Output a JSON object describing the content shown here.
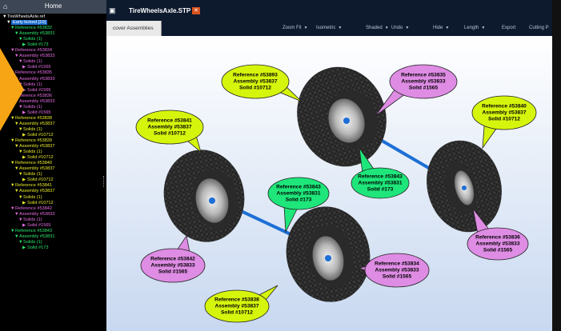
{
  "colors": {
    "yellow": "#d6f50d",
    "pink": "#de8ce4",
    "green": "#1ee67a",
    "selection": "#1e6fd0",
    "tab_close": "#d9531e"
  },
  "left_panel": {
    "home_label": "Home",
    "home_icon": "home-icon",
    "tree": [
      {
        "text": "TireWheelsAxle.ref",
        "color": "#ffffff",
        "indent": 0,
        "tri": "down"
      },
      {
        "text": "Early kicked [10]",
        "color": "#ffffff",
        "indent": 1,
        "tri": "down",
        "selected": true
      },
      {
        "text": "Reference #53832",
        "color": "#2de86d",
        "indent": 2,
        "tri": "down"
      },
      {
        "text": "Assembly #53831",
        "color": "#2de86d",
        "indent": 3,
        "tri": "down"
      },
      {
        "text": "Solids (1)",
        "color": "#2de86d",
        "indent": 4,
        "tri": "down"
      },
      {
        "text": "Solid #173",
        "color": "#2de86d",
        "indent": 5,
        "tri": "right"
      },
      {
        "text": "Reference #53834",
        "color": "#e86de4",
        "indent": 2,
        "tri": "down"
      },
      {
        "text": "Assembly #53833",
        "color": "#e86de4",
        "indent": 3,
        "tri": "down"
      },
      {
        "text": "Solids (1)",
        "color": "#e86de4",
        "indent": 4,
        "tri": "down"
      },
      {
        "text": "Solid #1565",
        "color": "#e86de4",
        "indent": 5,
        "tri": "right"
      },
      {
        "text": "Reference #53835",
        "color": "#e86de4",
        "indent": 2,
        "tri": "down"
      },
      {
        "text": "Assembly #53833",
        "color": "#e86de4",
        "indent": 3,
        "tri": "down"
      },
      {
        "text": "Solids (1)",
        "color": "#e86de4",
        "indent": 4,
        "tri": "down"
      },
      {
        "text": "Solid #1565",
        "color": "#e86de4",
        "indent": 5,
        "tri": "right"
      },
      {
        "text": "Reference #53836",
        "color": "#e86de4",
        "indent": 2,
        "tri": "down"
      },
      {
        "text": "Assembly #53833",
        "color": "#e86de4",
        "indent": 3,
        "tri": "down"
      },
      {
        "text": "Solids (1)",
        "color": "#e86de4",
        "indent": 4,
        "tri": "down"
      },
      {
        "text": "Solid #1565",
        "color": "#e86de4",
        "indent": 5,
        "tri": "right"
      },
      {
        "text": "Reference #53838",
        "color": "#e8ea2a",
        "indent": 2,
        "tri": "down"
      },
      {
        "text": "Assembly #53837",
        "color": "#e8ea2a",
        "indent": 3,
        "tri": "down"
      },
      {
        "text": "Solids (1)",
        "color": "#e8ea2a",
        "indent": 4,
        "tri": "down"
      },
      {
        "text": "Solid #10712",
        "color": "#e8ea2a",
        "indent": 5,
        "tri": "right"
      },
      {
        "text": "Reference #53839",
        "color": "#e8ea2a",
        "indent": 2,
        "tri": "down"
      },
      {
        "text": "Assembly #53837",
        "color": "#e8ea2a",
        "indent": 3,
        "tri": "down"
      },
      {
        "text": "Solids (1)",
        "color": "#e8ea2a",
        "indent": 4,
        "tri": "down"
      },
      {
        "text": "Solid #10712",
        "color": "#e8ea2a",
        "indent": 5,
        "tri": "right"
      },
      {
        "text": "Reference #53840",
        "color": "#e8ea2a",
        "indent": 2,
        "tri": "down"
      },
      {
        "text": "Assembly #53837",
        "color": "#e8ea2a",
        "indent": 3,
        "tri": "down"
      },
      {
        "text": "Solids (1)",
        "color": "#e8ea2a",
        "indent": 4,
        "tri": "down"
      },
      {
        "text": "Solid #10712",
        "color": "#e8ea2a",
        "indent": 5,
        "tri": "right"
      },
      {
        "text": "Reference #53841",
        "color": "#e8ea2a",
        "indent": 2,
        "tri": "down"
      },
      {
        "text": "Assembly #53837",
        "color": "#e8ea2a",
        "indent": 3,
        "tri": "down"
      },
      {
        "text": "Solids (1)",
        "color": "#e8ea2a",
        "indent": 4,
        "tri": "down"
      },
      {
        "text": "Solid #10712",
        "color": "#e8ea2a",
        "indent": 5,
        "tri": "right"
      },
      {
        "text": "Reference #53842",
        "color": "#e86de4",
        "indent": 2,
        "tri": "down"
      },
      {
        "text": "Assembly #53833",
        "color": "#e86de4",
        "indent": 3,
        "tri": "down"
      },
      {
        "text": "Solids (1)",
        "color": "#e86de4",
        "indent": 4,
        "tri": "down"
      },
      {
        "text": "Solid #1565",
        "color": "#e86de4",
        "indent": 5,
        "tri": "right"
      },
      {
        "text": "Reference #53843",
        "color": "#2de86d",
        "indent": 2,
        "tri": "down"
      },
      {
        "text": "Assembly #53831",
        "color": "#2de86d",
        "indent": 3,
        "tri": "down"
      },
      {
        "text": "Solids (1)",
        "color": "#2de86d",
        "indent": 4,
        "tri": "down"
      },
      {
        "text": "Solid #173",
        "color": "#2de86d",
        "indent": 5,
        "tri": "right"
      }
    ]
  },
  "tab": {
    "icon": "model-icon",
    "title": "TireWheelsAxle.STP",
    "close_icon": "close-icon"
  },
  "toolbar": {
    "discover_label": "cover Assemblies",
    "items": [
      {
        "label": "Zoom Fit",
        "caret": true
      },
      {
        "label": "Isometric",
        "caret": true
      },
      {
        "label": "Shaded",
        "caret": true
      },
      {
        "label": "Undo",
        "caret": true
      },
      {
        "label": "Hide",
        "caret": true
      },
      {
        "label": "Length",
        "caret": true
      },
      {
        "label": "Export",
        "caret": false
      },
      {
        "label": "Cutting P",
        "caret": false
      }
    ]
  },
  "callouts": [
    {
      "id": "c1",
      "lines": [
        "Reference #53893",
        "Assembly #53837",
        "Solid #10712"
      ],
      "color": "yellow"
    },
    {
      "id": "c2",
      "lines": [
        "Reference #53835",
        "Assembly #53833",
        "Solid #1565"
      ],
      "color": "pink"
    },
    {
      "id": "c3",
      "lines": [
        "Reference #53840",
        "Assembly #53837",
        "Solid #10712"
      ],
      "color": "yellow"
    },
    {
      "id": "c4",
      "lines": [
        "Reference #53841",
        "Assembly #53837",
        "Solid #10712"
      ],
      "color": "yellow"
    },
    {
      "id": "c5",
      "lines": [
        "Reference #53843",
        "Assembly #53831",
        "Solid #173"
      ],
      "color": "green"
    },
    {
      "id": "c6",
      "lines": [
        "Reference #53843",
        "Assembly #53831",
        "Solid #173"
      ],
      "color": "green"
    },
    {
      "id": "c7",
      "lines": [
        "Reference #53836",
        "Assembly #53833",
        "Solid #1565"
      ],
      "color": "pink"
    },
    {
      "id": "c8",
      "lines": [
        "Reference #53842",
        "Assembly #53833",
        "Solid #1565"
      ],
      "color": "pink"
    },
    {
      "id": "c9",
      "lines": [
        "Reference #53834",
        "Assembly #53833",
        "Solid #1565"
      ],
      "color": "pink"
    },
    {
      "id": "c10",
      "lines": [
        "Reference #53838",
        "Assembly #53837",
        "Solid #10712"
      ],
      "color": "yellow"
    }
  ]
}
